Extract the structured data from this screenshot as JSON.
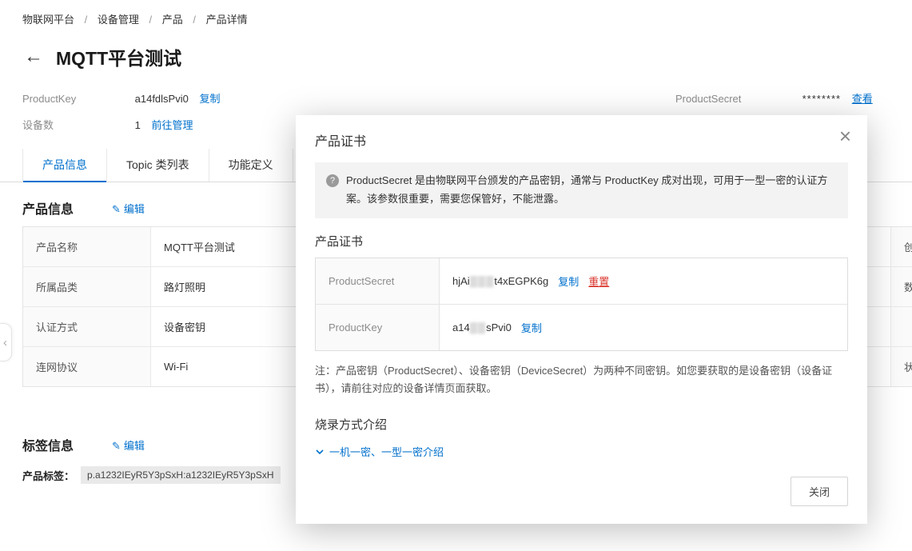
{
  "icons": {
    "back": "←",
    "edit": "✎",
    "close": "×",
    "collapse": "‹",
    "question": "?"
  },
  "page": {
    "breadcrumb": [
      "物联网平台",
      "设备管理",
      "产品",
      "产品详情"
    ],
    "breadcrumb_separator": "/",
    "title": "MQTT平台测试",
    "meta": {
      "product_key_label": "ProductKey",
      "product_key_value": "a14fdlsPvi0",
      "copy_label": "复制",
      "device_count_label": "设备数",
      "device_count_value": "1",
      "manage_link": "前往管理",
      "product_secret_label": "ProductSecret",
      "product_secret_value": "********",
      "view_link": "查看"
    },
    "tabs": [
      "产品信息",
      "Topic 类列表",
      "功能定义"
    ],
    "product_info": {
      "heading": "产品信息",
      "edit_link": "编辑",
      "rows": [
        {
          "label": "产品名称",
          "value": "MQTT平台测试",
          "right": "创"
        },
        {
          "label": "所属品类",
          "value": "路灯照明",
          "right": "数"
        },
        {
          "label": "认证方式",
          "value": "设备密钥",
          "right": ""
        },
        {
          "label": "连网协议",
          "value": "Wi-Fi",
          "right": "状"
        }
      ]
    },
    "tag_info": {
      "heading": "标签信息",
      "edit_link": "编辑",
      "label": "产品标签：",
      "tag": "p.a1232IEyR5Y3pSxH:a1232IEyR5Y3pSxH"
    }
  },
  "modal": {
    "title": "产品证书",
    "banner_text": "ProductSecret 是由物联网平台颁发的产品密钥，通常与 ProductKey 成对出现，可用于一型一密的认证方案。该参数很重要，需要您保管好，不能泄露。",
    "cert_heading": "产品证书",
    "rows": [
      {
        "label": "ProductSecret",
        "prefix": "hjAi",
        "masked": "▒▒▒",
        "suffix": "t4xEGPK6g",
        "copy": "复制",
        "reset": "重置"
      },
      {
        "label": "ProductKey",
        "prefix": "a14",
        "masked": "▒▒",
        "suffix": "sPvi0",
        "copy": "复制"
      }
    ],
    "note": "注：产品密钥（ProductSecret）、设备密钥（DeviceSecret）为两种不同密钥。如您要获取的是设备密钥（设备证书），请前往对应的设备详情页面获取。",
    "burn_heading": "烧录方式介绍",
    "expand_link": "一机一密、一型一密介绍",
    "close_button": "关闭"
  }
}
